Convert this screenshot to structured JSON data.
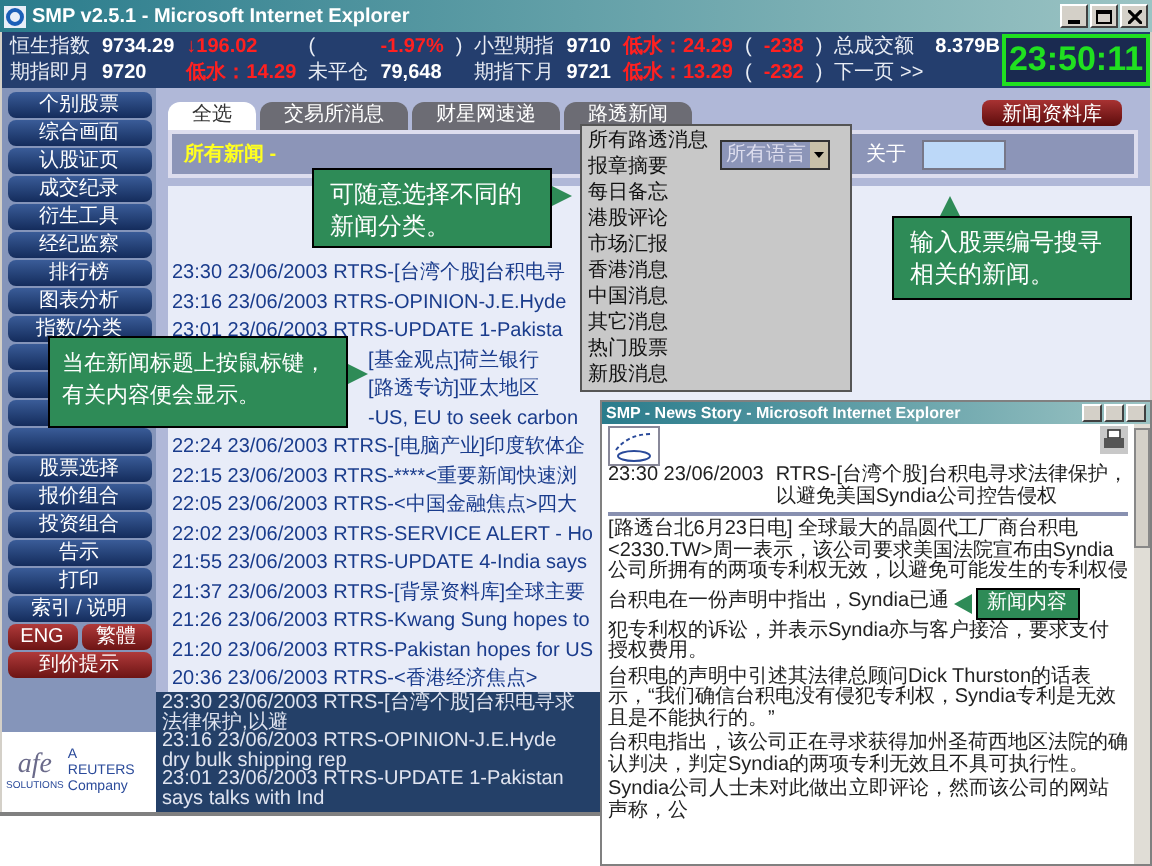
{
  "window": {
    "title": "SMP v2.5.1 - Microsoft Internet Explorer"
  },
  "quotes": {
    "rows": [
      [
        {
          "text": "恒生指数",
          "kind": "label"
        },
        {
          "text": "9734.29",
          "kind": "value"
        },
        {
          "text": "↓196.02",
          "kind": "change"
        },
        {
          "text": "(",
          "kind": "label"
        },
        {
          "text": "-1.97%",
          "kind": "change"
        },
        {
          "text": ")",
          "kind": "label"
        },
        {
          "text": "小型期指",
          "kind": "label"
        },
        {
          "text": "9710",
          "kind": "value"
        },
        {
          "text": "低水：24.29",
          "kind": "change"
        },
        {
          "text": "(",
          "kind": "label"
        },
        {
          "text": "-238",
          "kind": "change"
        },
        {
          "text": ")",
          "kind": "label"
        },
        {
          "text": "总成交额",
          "kind": "label"
        },
        {
          "text": "8.379B",
          "kind": "value"
        }
      ],
      [
        {
          "text": "期指即月",
          "kind": "label"
        },
        {
          "text": "9720",
          "kind": "value"
        },
        {
          "text": "低水：14.29",
          "kind": "change"
        },
        {
          "text": "未平仓",
          "kind": "label"
        },
        {
          "text": "79,648",
          "kind": "value"
        },
        {
          "kind": "empty"
        },
        {
          "text": "期指下月",
          "kind": "label"
        },
        {
          "text": "9721",
          "kind": "value"
        },
        {
          "text": "低水：13.29",
          "kind": "change"
        },
        {
          "text": "(",
          "kind": "label"
        },
        {
          "text": "-232",
          "kind": "change"
        },
        {
          "text": ")",
          "kind": "label"
        },
        {
          "text": "下一页 >>",
          "kind": "link"
        }
      ]
    ],
    "clock": "23:50:11"
  },
  "sidebar": {
    "items": [
      {
        "label": "个别股票",
        "kind": "nav"
      },
      {
        "label": "综合画面",
        "kind": "nav"
      },
      {
        "label": "认股证页",
        "kind": "nav"
      },
      {
        "label": "成交纪录",
        "kind": "nav"
      },
      {
        "label": "衍生工具",
        "kind": "nav"
      },
      {
        "label": "经纪监察",
        "kind": "nav"
      },
      {
        "label": "排行榜",
        "kind": "nav"
      },
      {
        "label": "图表分析",
        "kind": "nav"
      },
      {
        "label": "指数/分类",
        "kind": "nav"
      },
      {
        "kind": "covered"
      },
      {
        "kind": "covered"
      },
      {
        "kind": "covered"
      },
      {
        "kind": "covered"
      },
      {
        "label": "股票选择",
        "kind": "nav"
      },
      {
        "label": "报价组合",
        "kind": "nav"
      },
      {
        "label": "投资组合",
        "kind": "nav"
      },
      {
        "label": "告示",
        "kind": "nav"
      },
      {
        "label": "打印",
        "kind": "nav"
      },
      {
        "label": "索引 / 说明",
        "kind": "nav"
      }
    ],
    "language_buttons": [
      "ENG",
      "繁體"
    ],
    "alert_button": "到价提示",
    "logo": {
      "mark": "afe",
      "subtitle": "SOLUTIONS",
      "company": [
        "A",
        "REUTERS",
        "Company"
      ]
    }
  },
  "tabs": [
    {
      "label": "全选",
      "selected": true
    },
    {
      "label": "交易所消息",
      "selected": false
    },
    {
      "label": "财星网速递",
      "selected": false
    },
    {
      "label": "路透新闻",
      "selected": false
    }
  ],
  "archive_button": "新闻资料库",
  "filter": {
    "category": "所有新闻 -",
    "language": "所有语言",
    "about_label": "关于"
  },
  "category_menu": [
    "所有路透消息",
    "报章摘要",
    "每日备忘",
    "港股评论",
    "市场汇报",
    "香港消息",
    "中国消息",
    "其它消息",
    "热门股票",
    "新股消息"
  ],
  "news": [
    {
      "text": "23:30 23/06/2003 RTRS-[台湾个股]台积电寻",
      "kind": "full"
    },
    {
      "text": "23:16 23/06/2003 RTRS-OPINION-J.E.Hyde",
      "kind": "full"
    },
    {
      "text": "23:01 23/06/2003 RTRS-UPDATE 1-Pakista",
      "kind": "full"
    },
    {
      "text": "[基金观点]荷兰银行",
      "kind": "cut"
    },
    {
      "text": "[路透专访]亚太地区",
      "kind": "cut"
    },
    {
      "text": "-US, EU to seek carbon",
      "kind": "cut"
    },
    {
      "text": "22:24 23/06/2003 RTRS-[电脑产业]印度软体企",
      "kind": "full"
    },
    {
      "text": "22:15 23/06/2003 RTRS-****<重要新闻快速浏",
      "kind": "full"
    },
    {
      "text": "22:05 23/06/2003 RTRS-<中国金融焦点>四大",
      "kind": "full"
    },
    {
      "text": "22:02 23/06/2003 RTRS-SERVICE ALERT - Ho",
      "kind": "full"
    },
    {
      "text": "21:55 23/06/2003 RTRS-UPDATE 4-India says",
      "kind": "full"
    },
    {
      "text": "21:37 23/06/2003 RTRS-[背景资料库]全球主要",
      "kind": "full"
    },
    {
      "text": "21:26 23/06/2003 RTRS-Kwang Sung hopes to",
      "kind": "full"
    },
    {
      "text": "21:20 23/06/2003 RTRS-Pakistan hopes for US",
      "kind": "full"
    },
    {
      "text": "20:36 23/06/2003 RTRS-<香港经济焦点>",
      "kind": "full"
    }
  ],
  "ticker": [
    "23:30 23/06/2003 RTRS-[台湾个股]台积电寻求法律保护,以避",
    "23:16 23/06/2003 RTRS-OPINION-J.E.Hyde dry bulk shipping rep",
    "23:01 23/06/2003 RTRS-UPDATE 1-Pakistan says talks with Ind"
  ],
  "callouts": [
    {
      "text": "可随意选择不同的新闻分类。",
      "kind": "category"
    },
    {
      "text": "输入股票编号搜寻相关的新闻。",
      "kind": "search"
    },
    {
      "text": "当在新闻标题上按鼠标键，有关内容便会显示。",
      "kind": "headline"
    }
  ],
  "popup": {
    "title": "SMP - News Story - Microsoft Internet Explorer",
    "time": "23:30 23/06/2003",
    "headline": "RTRS-[台湾个股]台积电寻求法律保护，以避免美国Syndia公司控告侵权",
    "callout": "新闻内容",
    "paragraphs": [
      "[路透台北6月23日电] 全球最大的晶圆代工厂商台积电<2330.TW>周一表示，该公司要求美国法院宣布由Syndia公司所拥有的两项专利权无效，以避免可能发生的专利权侵",
      "台积电在一份声明中指出，Syndia已通",
      "犯专利权的诉讼，并表示Syndia亦与客户接洽，要求支付授权费用。",
      "台积电的声明中引述其法律总顾问Dick Thurston的话表示，“我们确信台积电没有侵犯专利权，Syndia专利是无效且是不能执行的。”",
      "台积电指出，该公司正在寻求获得加州圣荷西地区法院的确认判决，判定Syndia的两项专利无效且不具可执行性。",
      "Syndia公司人士未对此做出立即评论，然而该公司的网站声称，公"
    ]
  }
}
